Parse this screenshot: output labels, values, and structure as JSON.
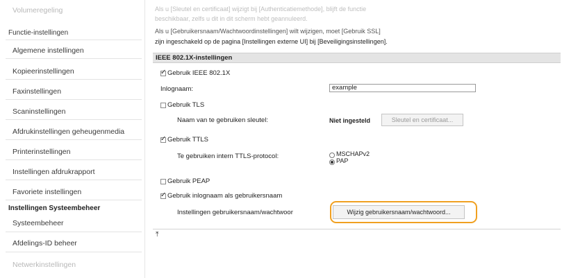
{
  "sidebar": {
    "items": [
      {
        "label": "Volumeregeling",
        "kind": "faded"
      },
      {
        "label": "Functie-instellingen",
        "kind": "head-normal"
      },
      {
        "label": "Algemene instellingen",
        "kind": "item"
      },
      {
        "label": "Kopieerinstellingen",
        "kind": "item"
      },
      {
        "label": "Faxinstellingen",
        "kind": "item"
      },
      {
        "label": "Scaninstellingen",
        "kind": "item"
      },
      {
        "label": "Afdrukinstellingen geheugenmedia",
        "kind": "item"
      },
      {
        "label": "Printerinstellingen",
        "kind": "item"
      },
      {
        "label": "Instellingen afdrukrapport",
        "kind": "item"
      },
      {
        "label": "Favoriete instellingen",
        "kind": "item"
      },
      {
        "label": "Instellingen Systeembeheer",
        "kind": "head"
      },
      {
        "label": "Systeembeheer",
        "kind": "item"
      },
      {
        "label": "Afdelings-ID beheer",
        "kind": "item"
      },
      {
        "label": "Netwerkinstellingen",
        "kind": "faded"
      }
    ]
  },
  "notes": {
    "line0": "Als u [Sleutel en certificaat] wijzigt bij [Authenticatiemethode], blijft de functie",
    "line1": "beschikbaar, zelfs u dit in dit scherm hebt geannuleerd.",
    "line2": "Als u [Gebruikersnaam/Wachtwoordinstellingen] wilt wijzigen, moet [Gebruik SSL]",
    "line3": "zijn ingeschakeld op de pagina [Instellingen externe UI] bij [Beveiligingsinstellingen]."
  },
  "panel": {
    "title": "IEEE 802.1X-instellingen",
    "use_ieee": {
      "label": "Gebruik IEEE 802.1X",
      "checked": true
    },
    "login_name": {
      "label": "Inlognaam:",
      "value": "example"
    },
    "use_tls": {
      "label": "Gebruik TLS",
      "checked": false
    },
    "key_label": "Naam van te gebruiken sleutel:",
    "key_status": "Niet ingesteld",
    "key_button": "Sleutel en certificaat...",
    "use_ttls": {
      "label": "Gebruik TTLS",
      "checked": true
    },
    "ttls_protocol_label": "Te gebruiken intern TTLS-protocol:",
    "ttls_options": [
      {
        "label": "MSCHAPv2",
        "selected": false
      },
      {
        "label": "PAP",
        "selected": true
      }
    ],
    "use_peap": {
      "label": "Gebruik PEAP",
      "checked": false
    },
    "use_login_as_user": {
      "label": "Gebruik inlognaam als gebruikersnaam",
      "checked": true
    },
    "user_pw_label": "Instellingen gebruikersnaam/wachtwoor",
    "user_pw_button": "Wijzig gebruikersnaam/wachtwoord..."
  },
  "top_icon": "to-top-icon",
  "colors": {
    "highlight": "#f0a020",
    "panel_header": "#e4e4e4"
  }
}
